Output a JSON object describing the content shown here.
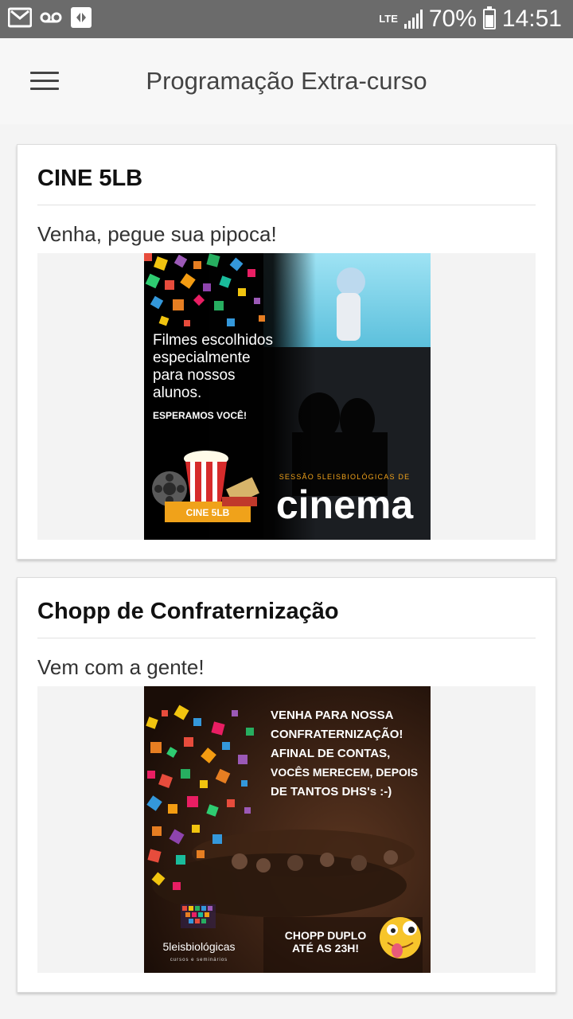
{
  "status_bar": {
    "network": "LTE",
    "battery": "70%",
    "time": "14:51",
    "icons": [
      "gmail-icon",
      "voicemail-icon",
      "app-notification-icon",
      "signal-icon",
      "battery-icon"
    ]
  },
  "app_bar": {
    "title": "Programação Extra-curso",
    "menu_icon": "hamburger-menu-icon"
  },
  "events": [
    {
      "title": "CINE 5LB",
      "subtitle": "Venha, pegue sua pipoca!",
      "poster": {
        "text_lines": [
          "Filmes escolhidos",
          "especialmente",
          "para nossos",
          "alunos."
        ],
        "cta": "ESPERAMOS VOCÊ!",
        "badge": "CINE 5LB",
        "session_label": "SESSÃO 5LEISBIOLÓGICAS DE",
        "big_word": "cinema"
      }
    },
    {
      "title": "Chopp de Confraternização",
      "subtitle": "Vem com a gente!",
      "poster": {
        "text_lines": [
          "VENHA PARA NOSSA",
          "CONFRATERNIZAÇÃO!",
          "AFINAL DE CONTAS,",
          "VOCÊS MERECEM, DEPOIS",
          "DE TANTOS DHS's :-)"
        ],
        "promo_lines": [
          "CHOPP DUPLO",
          "ATÉ AS 23H!"
        ],
        "brand": "5leisbiológicas",
        "brand_tagline": "cursos e seminários"
      }
    }
  ],
  "colors": {
    "status_bar": "#6b6b6b",
    "background": "#f4f4f4",
    "card": "#ffffff"
  }
}
